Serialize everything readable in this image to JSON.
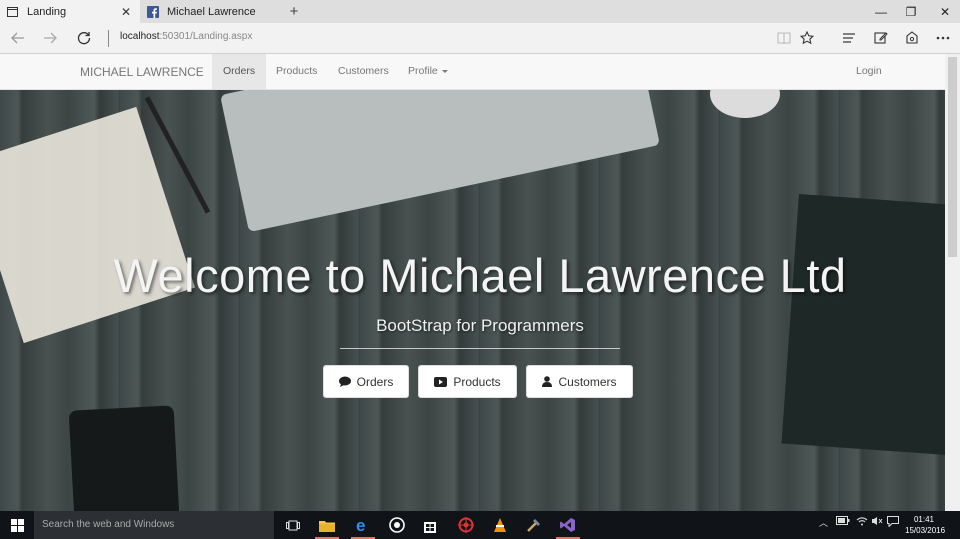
{
  "browser": {
    "tabs": [
      {
        "label": "Landing",
        "close": "✕"
      },
      {
        "label": "Michael Lawrence"
      }
    ],
    "new_tab": "+",
    "window_controls": {
      "minimize": "—",
      "restore": "❐",
      "close": "✕"
    },
    "address": {
      "host": "localhost",
      "port_path": ":50301/Landing.aspx"
    }
  },
  "site_nav": {
    "brand": "MICHAEL LAWRENCE",
    "items": [
      {
        "label": "Orders"
      },
      {
        "label": "Products"
      },
      {
        "label": "Customers"
      },
      {
        "label": "Profile"
      }
    ],
    "login": "Login",
    "active_item": "Orders"
  },
  "hero": {
    "title": "Welcome to Michael Lawrence Ltd",
    "subtitle": "BootStrap for Programmers",
    "buttons": [
      {
        "label": "Orders",
        "icon": "comment-icon"
      },
      {
        "label": "Products",
        "icon": "youtube-play-icon"
      },
      {
        "label": "Customers",
        "icon": "user-icon"
      }
    ]
  },
  "taskbar": {
    "search_placeholder": "Search the web and Windows",
    "time": "01:41",
    "date": "15/03/2016"
  },
  "colors": {
    "accent_running": "#e0736d",
    "navbar_bg": "#f8f8f8",
    "taskbar_bg": "#101318"
  }
}
